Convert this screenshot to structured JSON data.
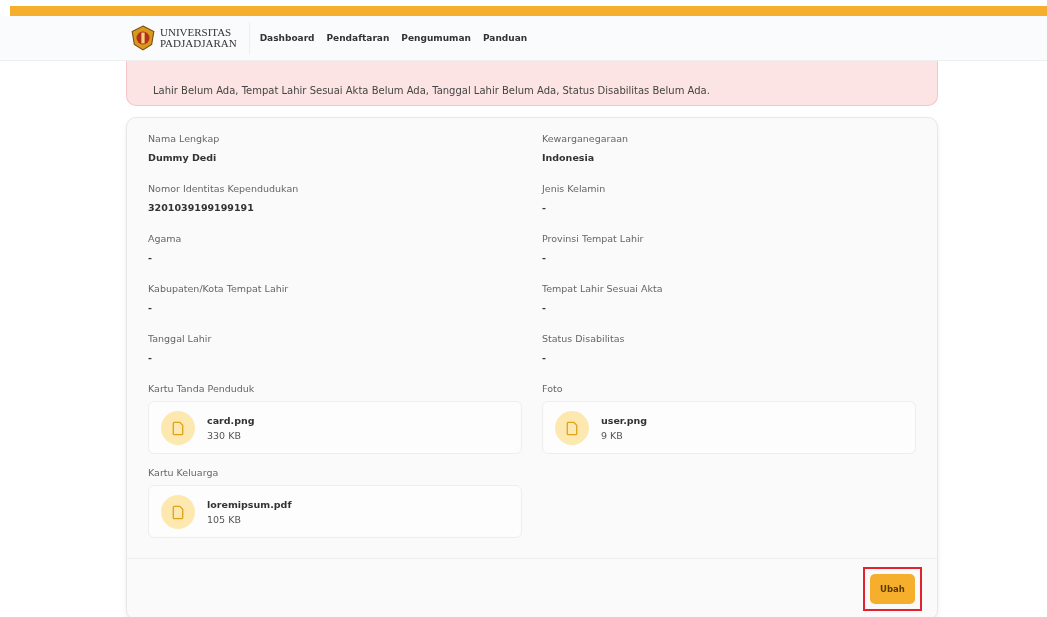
{
  "header": {
    "logo_line1": "UNIVERSITAS",
    "logo_line2": "PADJADJARAN",
    "nav": [
      {
        "label": "Dashboard"
      },
      {
        "label": "Pendaftaran"
      },
      {
        "label": "Pengumuman"
      },
      {
        "label": "Panduan"
      }
    ]
  },
  "alert": {
    "text": "Lahir Belum Ada, Tempat Lahir Sesuai Akta Belum Ada, Tanggal Lahir Belum Ada, Status Disabilitas Belum Ada."
  },
  "fields": [
    {
      "kind": "text",
      "label": "Nama Lengkap",
      "value": "Dummy Dedi"
    },
    {
      "kind": "text",
      "label": "Kewarganegaraan",
      "value": "Indonesia"
    },
    {
      "kind": "text",
      "label": "Nomor Identitas Kependudukan",
      "value": "3201039199199191"
    },
    {
      "kind": "text",
      "label": "Jenis Kelamin",
      "value": "-"
    },
    {
      "kind": "text",
      "label": "Agama",
      "value": "-"
    },
    {
      "kind": "text",
      "label": "Provinsi Tempat Lahir",
      "value": "-"
    },
    {
      "kind": "text",
      "label": "Kabupaten/Kota Tempat Lahir",
      "value": "-"
    },
    {
      "kind": "text",
      "label": "Tempat Lahir Sesuai Akta",
      "value": "-"
    },
    {
      "kind": "text",
      "label": "Tanggal Lahir",
      "value": "-"
    },
    {
      "kind": "text",
      "label": "Status Disabilitas",
      "value": "-"
    },
    {
      "kind": "file",
      "label": "Kartu Tanda Penduduk",
      "file_name": "card.png",
      "file_size": "330 KB"
    },
    {
      "kind": "file",
      "label": "Foto",
      "file_name": "user.png",
      "file_size": "9 KB"
    },
    {
      "kind": "file",
      "label": "Kartu Keluarga",
      "file_name": "loremipsum.pdf",
      "file_size": "105 KB"
    }
  ],
  "button": {
    "label": "Ubah",
    "highlighted": true
  }
}
